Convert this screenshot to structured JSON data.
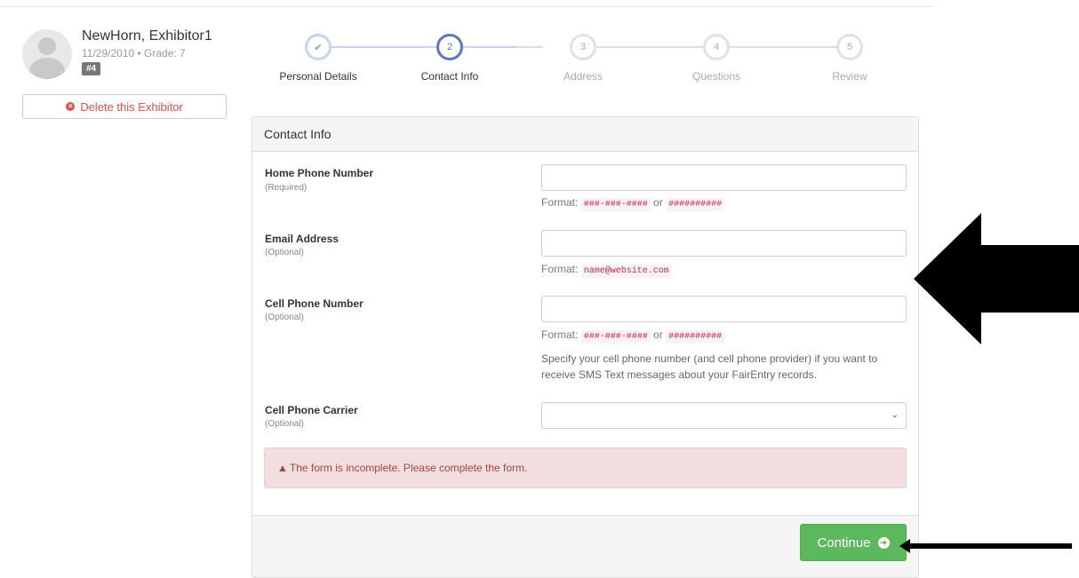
{
  "exhibitor": {
    "name": "NewHorn, Exhibitor1",
    "meta": "11/29/2010 • Grade: 7",
    "badge": "#4",
    "delete_label": "Delete this Exhibitor"
  },
  "steps": [
    {
      "label": "Personal Details",
      "marker": "✔",
      "state": "completed"
    },
    {
      "label": "Contact Info",
      "marker": "2",
      "state": "active"
    },
    {
      "label": "Address",
      "marker": "3",
      "state": "pending"
    },
    {
      "label": "Questions",
      "marker": "4",
      "state": "pending"
    },
    {
      "label": "Review",
      "marker": "5",
      "state": "pending"
    }
  ],
  "panel": {
    "title": "Contact Info",
    "home_phone": {
      "label": "Home Phone Number",
      "note": "(Required)",
      "value": "",
      "format_prefix": "Format:",
      "format1": "###-###-####",
      "or": "or",
      "format2": "##########"
    },
    "email": {
      "label": "Email Address",
      "note": "(Optional)",
      "value": "",
      "format_prefix": "Format:",
      "format1": "name@website.com"
    },
    "cell_phone": {
      "label": "Cell Phone Number",
      "note": "(Optional)",
      "value": "",
      "format_prefix": "Format:",
      "format1": "###-###-####",
      "or": "or",
      "format2": "##########",
      "help": "Specify your cell phone number (and cell phone provider) if you want to receive SMS Text messages about your FairEntry records."
    },
    "carrier": {
      "label": "Cell Phone Carrier",
      "note": "(Optional)",
      "value": ""
    },
    "alert": "The form is incomplete. Please complete the form.",
    "continue_label": "Continue"
  },
  "colors": {
    "accent": "#5b74c6",
    "success": "#5cb85c",
    "danger": "#d9534f",
    "alert_bg": "#f2dede"
  }
}
